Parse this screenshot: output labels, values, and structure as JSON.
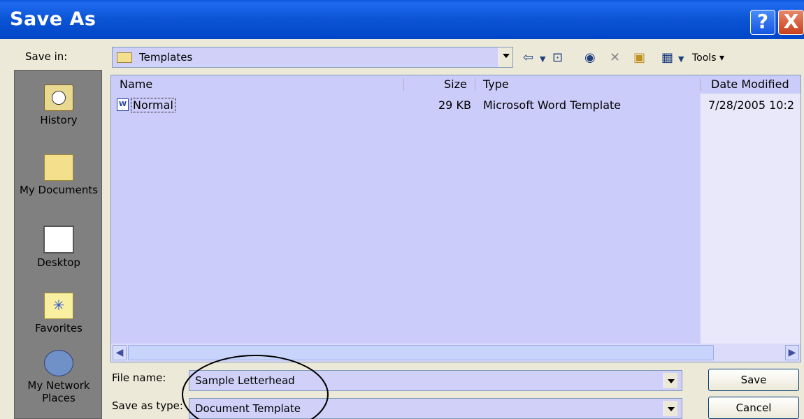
{
  "window": {
    "title": "Save As",
    "help_label": "?",
    "close_label": "X"
  },
  "toolbar": {
    "save_in_label": "Save in:",
    "location": "Templates",
    "tools_label": "Tools"
  },
  "places": [
    {
      "label": "History",
      "icon": "history-icon"
    },
    {
      "label": "My Documents",
      "icon": "my-documents-icon"
    },
    {
      "label": "Desktop",
      "icon": "desktop-icon"
    },
    {
      "label": "Favorites",
      "icon": "favorites-icon"
    },
    {
      "label": "My Network",
      "label2": "Places",
      "icon": "network-places-icon"
    }
  ],
  "file_list": {
    "columns": [
      "Name",
      "Size",
      "Type",
      "Date Modified"
    ],
    "rows": [
      {
        "name": "Normal",
        "size": "29 KB",
        "type": "Microsoft Word Template",
        "date": "7/28/2005 10:2",
        "icon": "word-template-icon"
      }
    ]
  },
  "form": {
    "file_name_label": "File name:",
    "file_name_value": "Sample Letterhead",
    "save_type_label": "Save as type:",
    "save_type_value": "Document Template"
  },
  "buttons": {
    "save": "Save",
    "cancel": "Cancel"
  }
}
